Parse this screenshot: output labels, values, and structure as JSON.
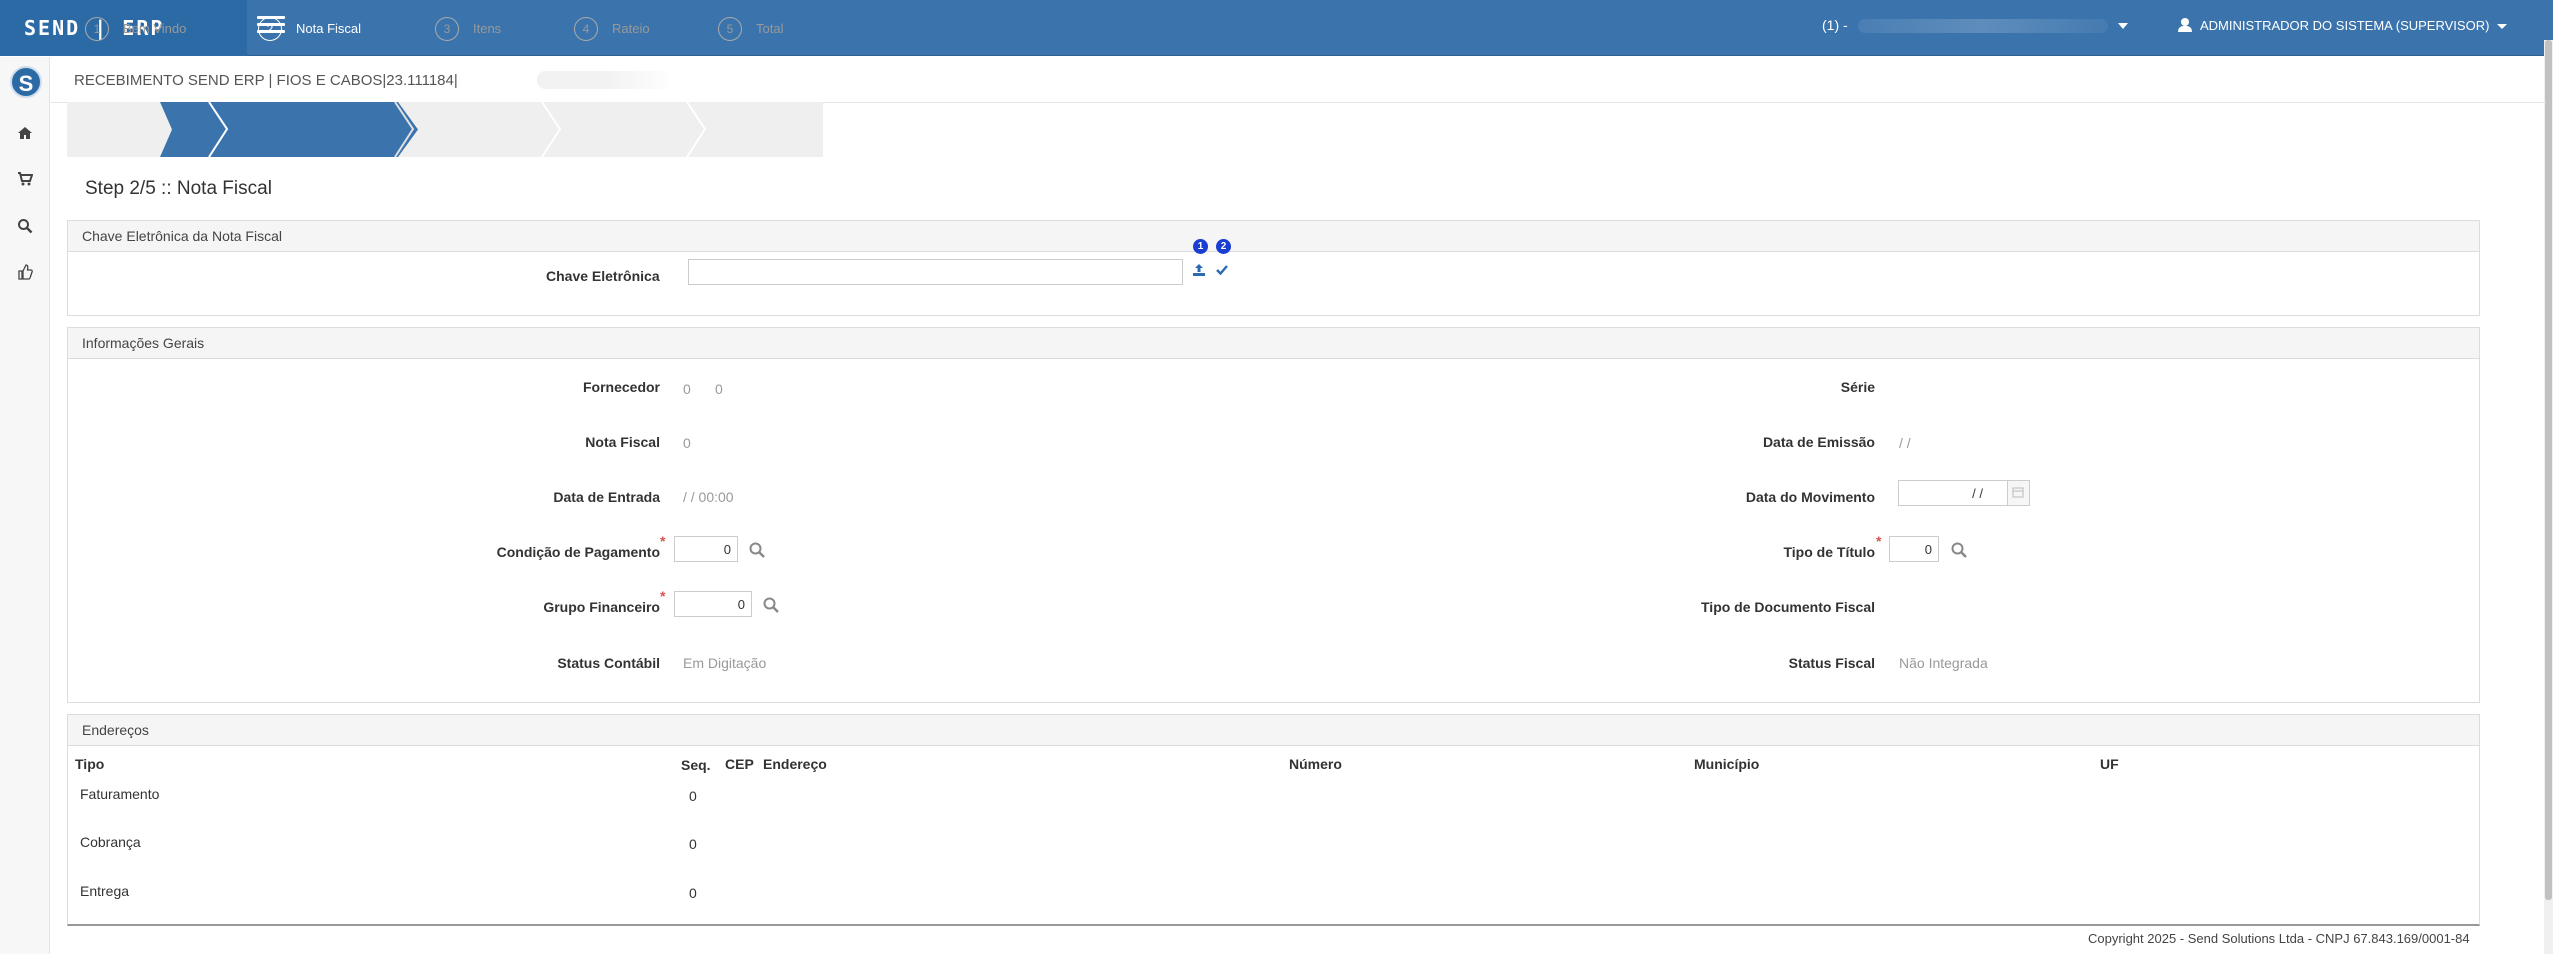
{
  "topbar": {
    "brand": "SEND | ERP",
    "company_prefix": "(1) -",
    "user": "ADMINISTRADOR DO SISTEMA (SUPERVISOR)"
  },
  "page": {
    "title": "RECEBIMENTO SEND ERP | FIOS E CABOS|23.111184|",
    "step_title": "Step 2/5 :: Nota Fiscal"
  },
  "wizard": {
    "steps": [
      {
        "num": "1",
        "label": "Bem Vindo"
      },
      {
        "num": "2",
        "label": "Nota Fiscal"
      },
      {
        "num": "3",
        "label": "Itens"
      },
      {
        "num": "4",
        "label": "Rateio"
      },
      {
        "num": "5",
        "label": "Total"
      }
    ],
    "active_step": 2
  },
  "chave": {
    "header": "Chave Eletrônica da Nota Fiscal",
    "label": "Chave Eletrônica",
    "value": "",
    "badge1": "1",
    "badge2": "2"
  },
  "info": {
    "header": "Informações Gerais",
    "fornecedor_label": "Fornecedor",
    "fornecedor_code": "0",
    "fornecedor_name": "0",
    "serie_label": "Série",
    "nota_label": "Nota Fiscal",
    "nota_value": "0",
    "emissao_label": "Data de Emissão",
    "emissao_value": "/ /",
    "entrada_label": "Data de Entrada",
    "entrada_value": "/ / 00:00",
    "movimento_label": "Data do Movimento",
    "movimento_value": "/ /",
    "condicao_label": "Condição de Pagamento",
    "condicao_value": "0",
    "tipo_titulo_label": "Tipo de Título",
    "tipo_titulo_value": "0",
    "grupo_label": "Grupo Financeiro",
    "grupo_value": "0",
    "tipo_doc_label": "Tipo de Documento Fiscal",
    "status_contabil_label": "Status Contábil",
    "status_contabil_value": "Em Digitação",
    "status_fiscal_label": "Status Fiscal",
    "status_fiscal_value": "Não Integrada"
  },
  "enderecos": {
    "header": "Endereços",
    "columns": {
      "tipo": "Tipo",
      "seq": "Seq.",
      "cep": "CEP",
      "endereco": "Endereço",
      "numero": "Número",
      "municipio": "Município",
      "uf": "UF"
    },
    "rows": [
      {
        "tipo": "Faturamento",
        "seq": "0"
      },
      {
        "tipo": "Cobrança",
        "seq": "0"
      },
      {
        "tipo": "Entrega",
        "seq": "0"
      }
    ]
  },
  "footer": {
    "text": "Copyright 2025 - Send Solutions Ltda - CNPJ 67.843.169/0001-84"
  },
  "colors": {
    "primary": "#3b74ad",
    "brand_bg": "#2c6aa6",
    "required": "#d9534f",
    "badge": "#1a3ed1"
  }
}
